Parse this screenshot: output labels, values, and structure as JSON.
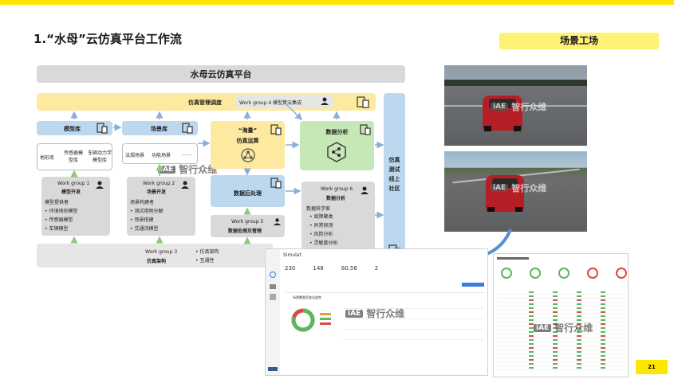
{
  "title": "1.“水母”云仿真平台工作流",
  "tag": "场景工场",
  "page_number": "21",
  "platform": {
    "header": "水母云仿真平台",
    "management": "仿真管理调度",
    "wg4": "Work group 4 模型算法集成",
    "model_lib": {
      "title": "模型库",
      "items": [
        "地形库",
        "传感器模型库",
        "车辆动力学模型库"
      ]
    },
    "scene_lib": {
      "title": "场景库",
      "items": [
        "法规场景",
        "功能场景",
        "……"
      ]
    },
    "massive": {
      "line1": "“海量”",
      "line2": "仿真运算"
    },
    "analysis": "数据分析",
    "postproc": "数据后处理",
    "wg1": {
      "head": "Work group 1",
      "title": "模型开发",
      "lead": "模型提供者",
      "items": [
        "环境地形模型",
        "传感器模型",
        "车辆模型"
      ]
    },
    "wg2": {
      "head": "Work group 2",
      "title": "场景开发",
      "lead": "场景构建者",
      "items": [
        "测试用例分解",
        "场景搭建",
        "交通流模型"
      ]
    },
    "wg5": {
      "head": "Work group 5",
      "title": "数据处理及管理"
    },
    "wg6": {
      "head": "Work group 6",
      "title": "数据分析",
      "lead": "数据科学家",
      "items": [
        "故障聚类",
        "异常探测",
        "风险分析",
        "灵敏度分析"
      ]
    },
    "wg3": {
      "head": "Work group 3",
      "title": "仿真架构",
      "items": [
        "仿真架构",
        "互通性"
      ]
    },
    "community": [
      "仿真",
      "测试",
      "线上",
      "社区"
    ]
  },
  "watermark": {
    "logo": "iAE",
    "text": "智行众维"
  },
  "screens": {
    "left": {
      "title": "Simulat",
      "stats": [
        "230",
        "148",
        "80.56",
        "2"
      ],
      "panel": "场景覆盖率变化趋势"
    }
  },
  "colors": {
    "accent": "#ffe600",
    "blue": "#bdd7ee",
    "green": "#c6e7b6",
    "yellow": "#fdeaa0",
    "gray": "#d9d9d9"
  }
}
